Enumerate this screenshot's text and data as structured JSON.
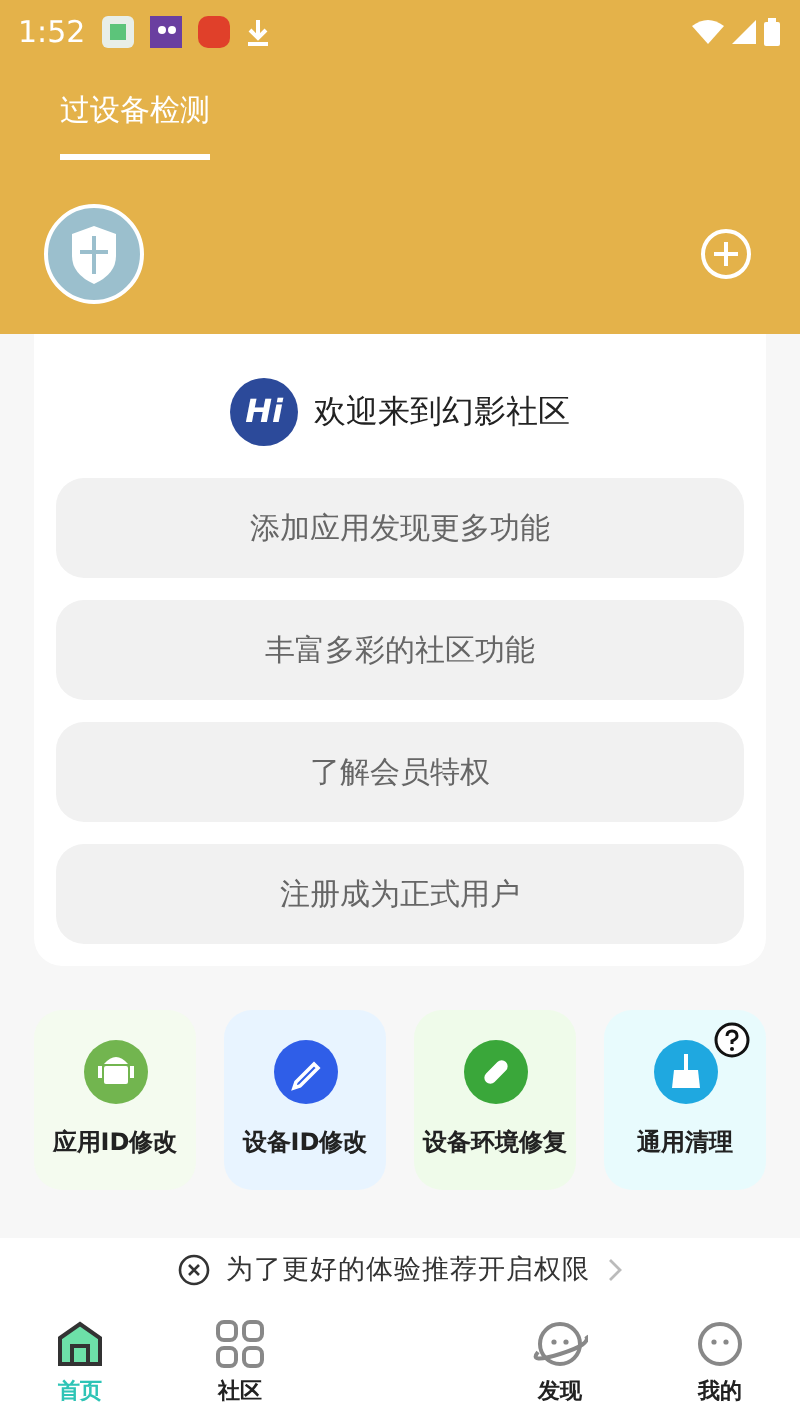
{
  "status_bar": {
    "time": "1:52"
  },
  "header": {
    "tabs": [
      {
        "label": "过设备检测",
        "selected": true
      }
    ]
  },
  "welcome": {
    "logo": "Hi",
    "title": "欢迎来到幻影社区"
  },
  "actions": [
    "添加应用发现更多功能",
    "丰富多彩的社区功能",
    "了解会员特权",
    "注册成为正式用户"
  ],
  "tools": [
    {
      "label": "应用ID修改",
      "kind": "android",
      "color": "#72b54f"
    },
    {
      "label": "设备ID修改",
      "kind": "pen",
      "color": "#2f5ee8"
    },
    {
      "label": "设备环境修复",
      "kind": "bandage",
      "color": "#3aa73a"
    },
    {
      "label": "通用清理",
      "kind": "broom",
      "color": "#1fa8e0"
    }
  ],
  "notice": {
    "text": "为了更好的体验推荐开启权限"
  },
  "bottom_nav": [
    {
      "label": "首页",
      "kind": "home",
      "selected": true
    },
    {
      "label": "社区",
      "kind": "grid",
      "selected": false
    },
    {
      "label": "发现",
      "kind": "planet",
      "selected": false
    },
    {
      "label": "我的",
      "kind": "face",
      "selected": false
    }
  ]
}
